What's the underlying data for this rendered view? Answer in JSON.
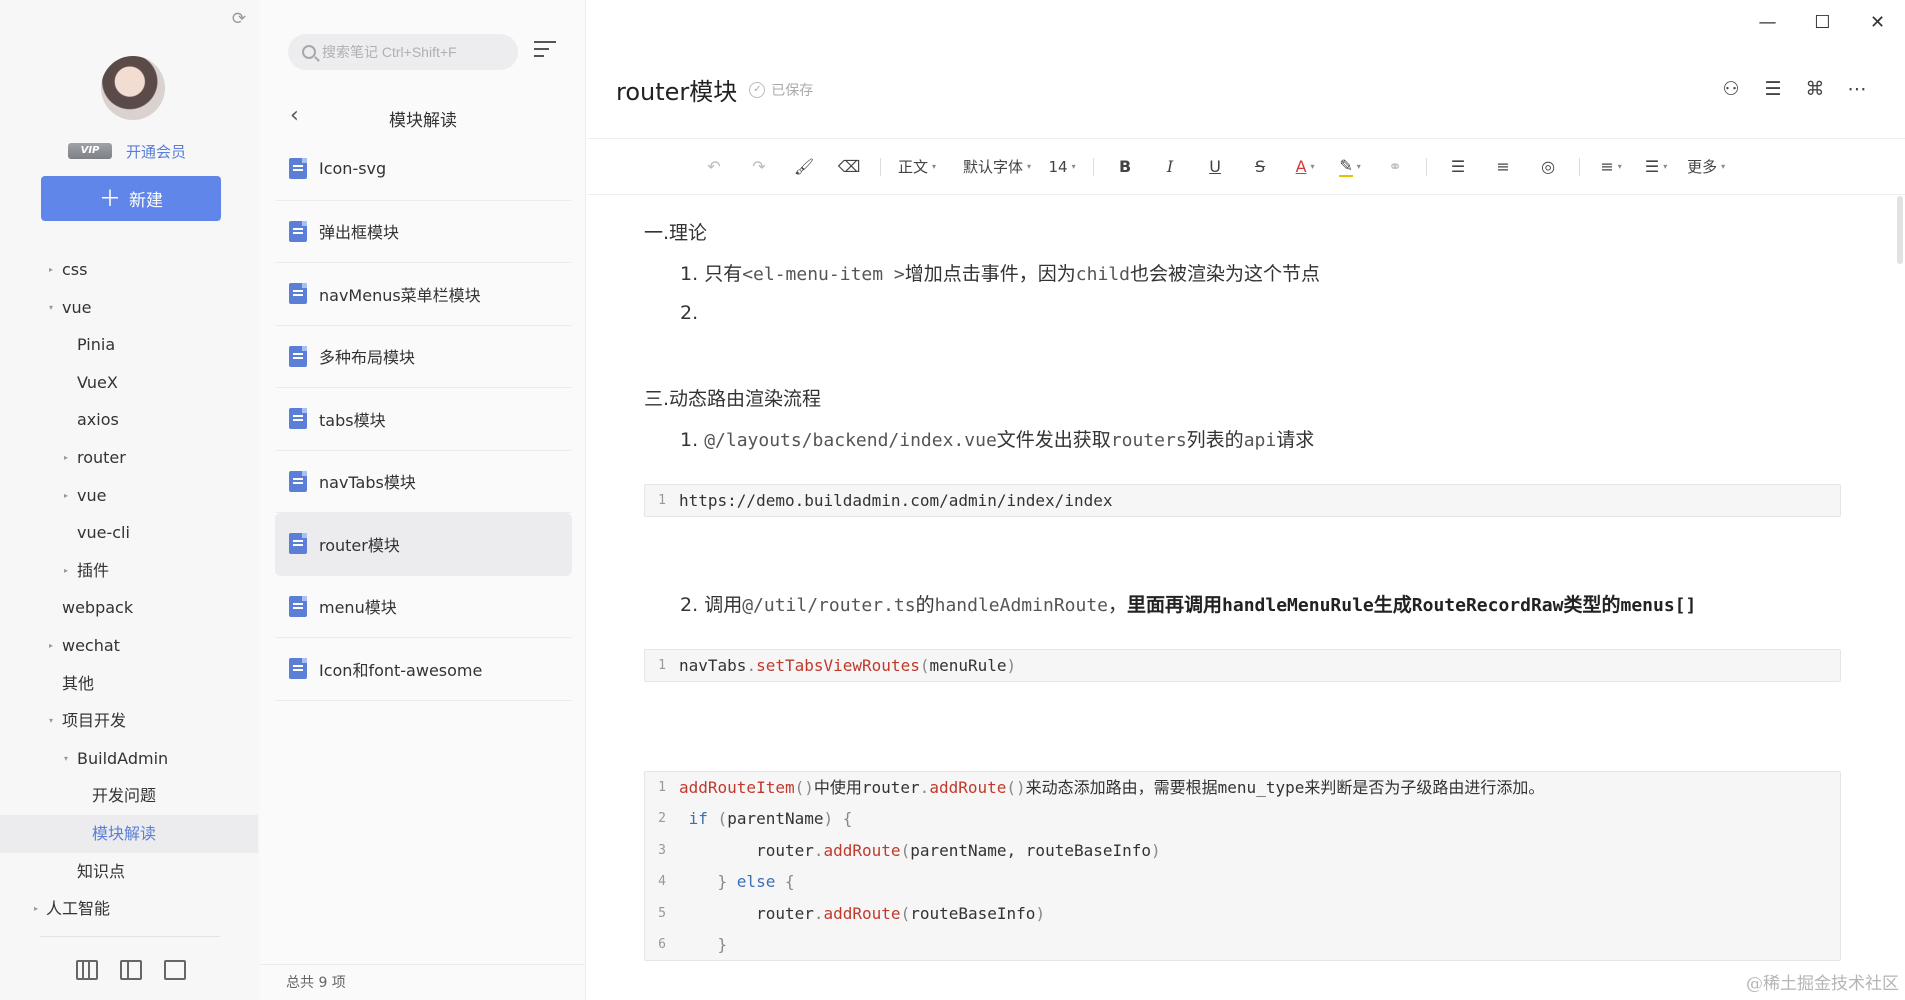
{
  "sidebar": {
    "vip_badge": "VIP",
    "open_member": "开通会员",
    "new_button": "新建",
    "tree": [
      {
        "label": "css",
        "level": 1,
        "caret": "▸"
      },
      {
        "label": "vue",
        "level": 1,
        "caret": "▾"
      },
      {
        "label": "Pinia",
        "level": 2,
        "caret": ""
      },
      {
        "label": "VueX",
        "level": 2,
        "caret": ""
      },
      {
        "label": "axios",
        "level": 2,
        "caret": ""
      },
      {
        "label": "router",
        "level": 2,
        "caret": "▸"
      },
      {
        "label": "vue",
        "level": 2,
        "caret": "▸"
      },
      {
        "label": "vue-cli",
        "level": 2,
        "caret": ""
      },
      {
        "label": "插件",
        "level": 2,
        "caret": "▸"
      },
      {
        "label": "webpack",
        "level": 1,
        "caret": ""
      },
      {
        "label": "wechat",
        "level": 1,
        "caret": "▸"
      },
      {
        "label": "其他",
        "level": 1,
        "caret": ""
      },
      {
        "label": "项目开发",
        "level": 1,
        "caret": "▾"
      },
      {
        "label": "BuildAdmin",
        "level": 2,
        "caret": "▾"
      },
      {
        "label": "开发问题",
        "level": 3,
        "caret": ""
      },
      {
        "label": "模块解读",
        "level": 3,
        "caret": "",
        "active": true
      },
      {
        "label": "知识点",
        "level": 2,
        "caret": ""
      },
      {
        "label": "人工智能",
        "level": 0,
        "caret": "▸"
      }
    ]
  },
  "notelist": {
    "search_placeholder": "搜索笔记 Ctrl+Shift+F",
    "title": "模块解读",
    "notes": [
      {
        "name": "Icon-svg"
      },
      {
        "name": "弹出框模块"
      },
      {
        "name": "navMenus菜单栏模块"
      },
      {
        "name": "多种布局模块"
      },
      {
        "name": "tabs模块"
      },
      {
        "name": "navTabs模块"
      },
      {
        "name": "router模块",
        "selected": true
      },
      {
        "name": "menu模块"
      },
      {
        "name": "Icon和font-awesome"
      }
    ],
    "footer": "总共 9 项"
  },
  "editor": {
    "title": "router模块",
    "saved": "已保存",
    "toolbar": {
      "paragraph": "正文",
      "font": "默认字体",
      "size": "14",
      "more": "更多"
    },
    "content": {
      "h1": "一.理论",
      "l1_num": "1.",
      "l1_a": "只有",
      "l1_code": "<el-menu-item >",
      "l1_b": "增加点击事件，因为",
      "l1_code2": "child",
      "l1_c": "也会被渲染为这个节点",
      "l2_num": "2.",
      "h3": "三.动态路由渲染流程",
      "l3_num": "1.",
      "l3_code": "@/layouts/backend/index.vue",
      "l3_a": "文件发出获取",
      "l3_code2": "routers",
      "l3_b": "列表的",
      "l3_code3": "api",
      "l3_c": "请求",
      "code1": "https://demo.buildadmin.com/admin/index/index",
      "l4_num": "2.",
      "l4_a": "调用",
      "l4_code": "@/util/router.ts",
      "l4_b": "的",
      "l4_code2": "handleAdminRoute",
      "l4_c": "，",
      "l4_bold_a": "里面再调用",
      "l4_bold_code": "handleMenuRule",
      "l4_bold_b": "生成",
      "l4_bold_code2": "RouteRecordRaw",
      "l4_bold_c": "类型的",
      "l4_bold_code3": "menus[]",
      "code2_obj": "navTabs",
      "code2_fn": "setTabsViewRoutes",
      "code2_arg": "menuRule",
      "code3": {
        "l1_fn": "addRouteItem",
        "l1_a": "中使用",
        "l1_obj": "router",
        "l1_fn2": "addRoute",
        "l1_b": "来动态添加路由，需要根据",
        "l1_var": "menu_type",
        "l1_c": "来判断是否为子级路由进行添加。",
        "l2_kw": "if",
        "l2_var": "parentName",
        "l3_obj": "router",
        "l3_fn": "addRoute",
        "l3_args": "parentName, routeBaseInfo",
        "l4_kw": "else",
        "l5_obj": "router",
        "l5_fn": "addRoute",
        "l5_args": "routeBaseInfo"
      }
    }
  },
  "watermark": "@稀土掘金技术社区"
}
